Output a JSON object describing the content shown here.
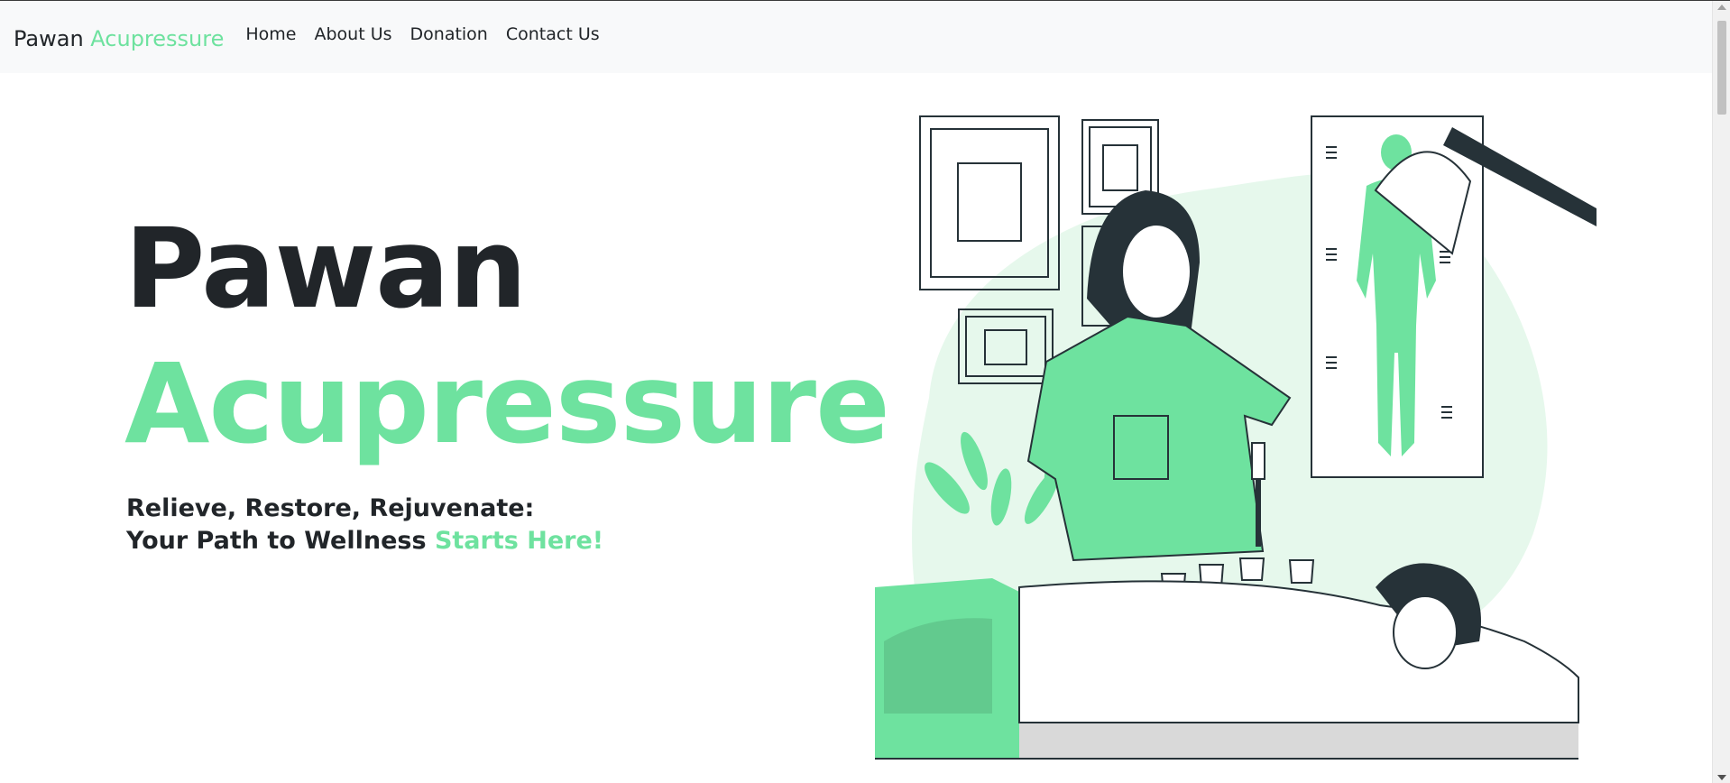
{
  "navbar": {
    "brand_part1": "Pawan",
    "brand_part2": "Acupressure",
    "links": [
      {
        "label": "Home"
      },
      {
        "label": "About Us"
      },
      {
        "label": "Donation"
      },
      {
        "label": "Contact Us"
      }
    ]
  },
  "hero": {
    "title_line1": "Pawan",
    "title_line2": "Acupressure",
    "tagline_line1": "Relieve, Restore, Rejuvenate:",
    "tagline_line2_prefix": "Your Path to Wellness",
    "tagline_line2_accent": "Starts Here!"
  },
  "colors": {
    "accent": "#6ee29f",
    "text": "#212529",
    "navbar_bg": "#f8f9fa",
    "illustration_dark": "#263238",
    "illustration_light": "#e6f8ec"
  },
  "icons": {
    "illustration": "acupressure-cupping-therapy-illustration"
  }
}
